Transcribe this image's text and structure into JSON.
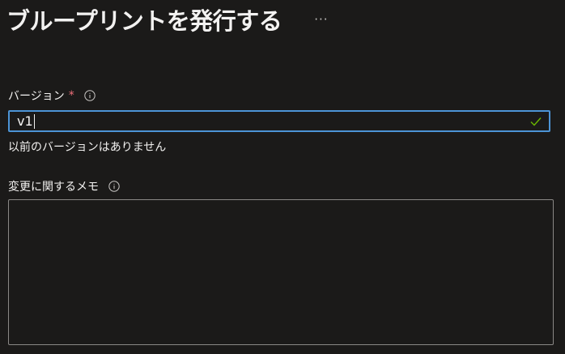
{
  "header": {
    "title": "ブループリントを発行する",
    "more_label": "···"
  },
  "version_field": {
    "label": "バージョン",
    "required_mark": "*",
    "info_icon": "info-icon",
    "value": "v1",
    "valid_icon": "checkmark-icon",
    "hint": "以前のバージョンはありません"
  },
  "notes_field": {
    "label": "変更に関するメモ",
    "info_icon": "info-icon",
    "value": ""
  },
  "colors": {
    "background": "#1b1a19",
    "text": "#f3f2f1",
    "focus_border": "#4c94d6",
    "required": "#f1707b",
    "valid": "#6bb700",
    "input_border": "#8a8886"
  }
}
